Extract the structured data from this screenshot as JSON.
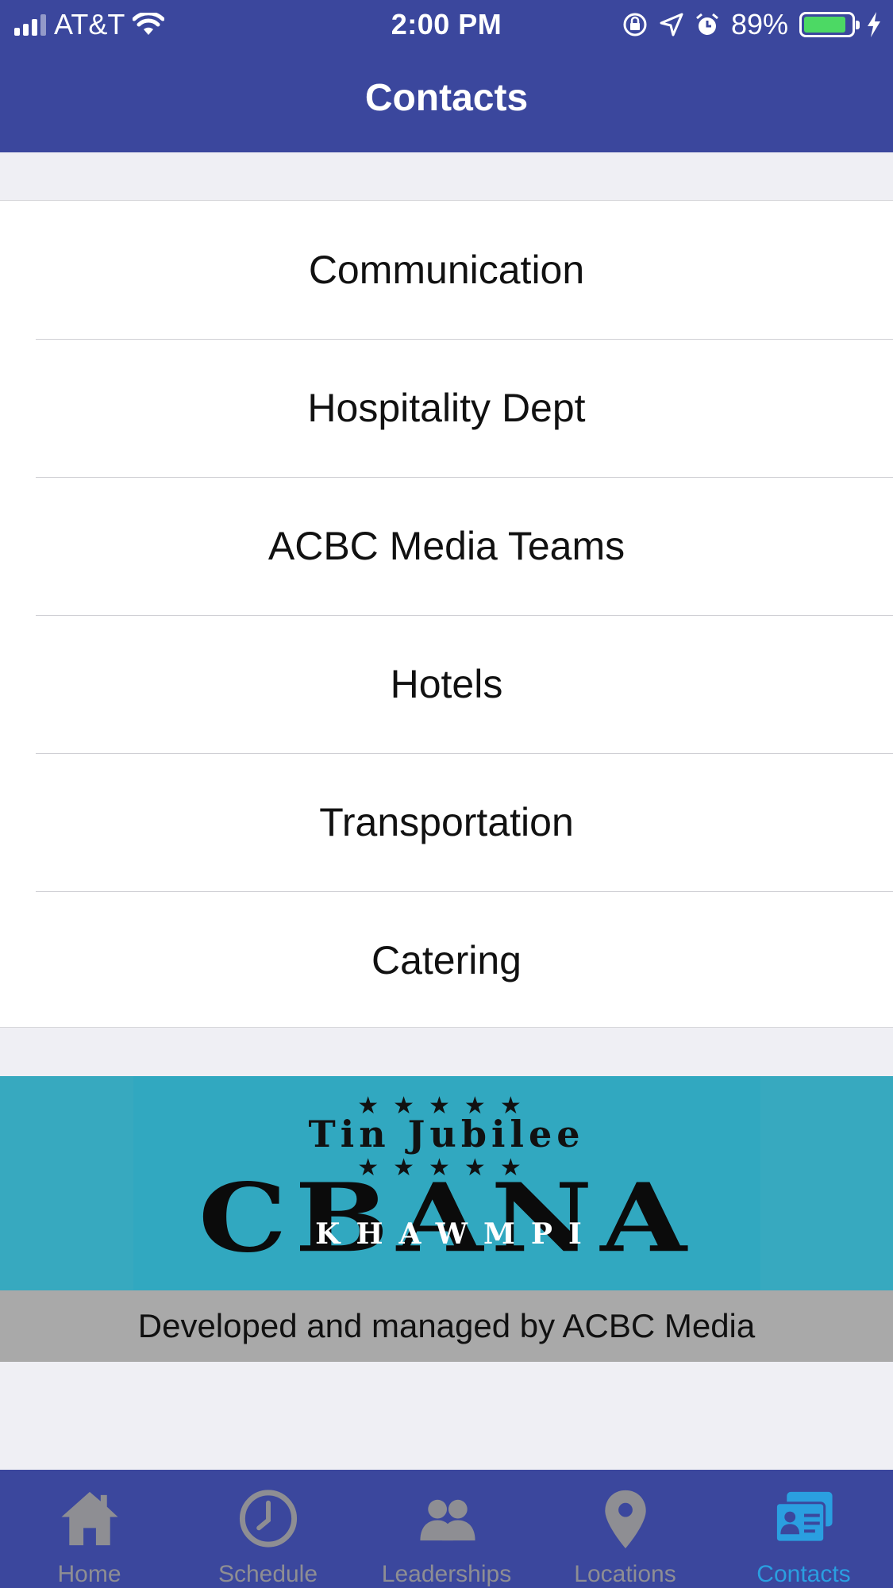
{
  "status_bar": {
    "carrier": "AT&T",
    "time": "2:00 PM",
    "battery": "89%",
    "battery_level": 0.89,
    "icons": [
      "signal-icon",
      "wifi-icon",
      "rotation-lock-icon",
      "location-icon",
      "alarm-icon",
      "battery-icon",
      "charging-icon"
    ]
  },
  "header": {
    "title": "Contacts"
  },
  "contacts_list": {
    "items": [
      {
        "label": "Communication"
      },
      {
        "label": "Hospitality Dept"
      },
      {
        "label": "ACBC Media Teams"
      },
      {
        "label": "Hotels"
      },
      {
        "label": "Transportation"
      },
      {
        "label": "Catering"
      }
    ]
  },
  "banner": {
    "stars": "★★★★★",
    "subtitle": "Tin Jubilee",
    "main_text": "CBANA",
    "overlay_text": "KHAWMPI",
    "colors": {
      "background": "#37a9bf"
    }
  },
  "footer": {
    "credit": "Developed and managed by ACBC Media"
  },
  "tab_bar": {
    "tabs": [
      {
        "label": "Home",
        "icon": "home-icon",
        "active": false
      },
      {
        "label": "Schedule",
        "icon": "clock-icon",
        "active": false
      },
      {
        "label": "Leaderships",
        "icon": "people-icon",
        "active": false
      },
      {
        "label": "Locations",
        "icon": "map-pin-icon",
        "active": false
      },
      {
        "label": "Contacts",
        "icon": "contact-card-icon",
        "active": true
      }
    ]
  },
  "colors": {
    "header_bg": "#3b479d",
    "tab_active": "#2a9fe0",
    "tab_inactive": "#8e8e93",
    "battery_fill": "#4cd964"
  }
}
